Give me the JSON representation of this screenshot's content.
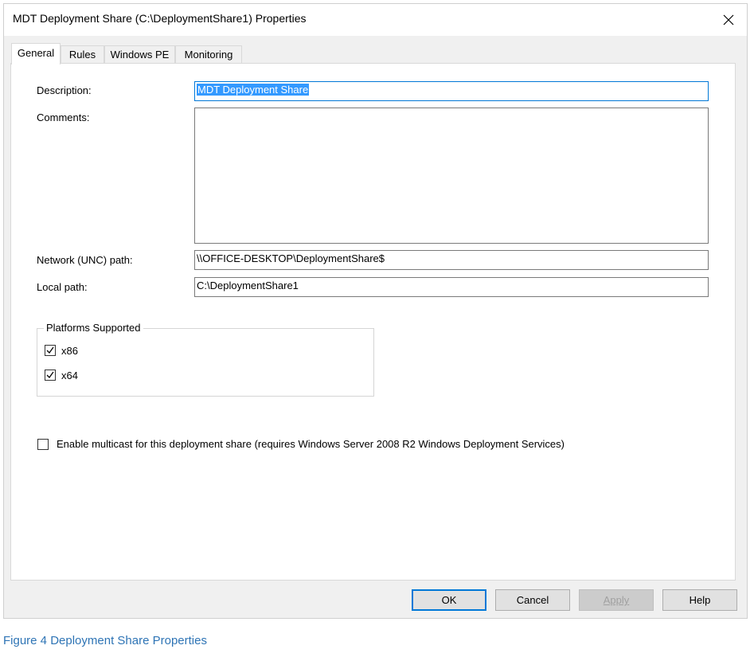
{
  "window": {
    "title": "MDT Deployment Share (C:\\DeploymentShare1) Properties"
  },
  "tabs": [
    {
      "label": "General",
      "active": true
    },
    {
      "label": "Rules",
      "active": false
    },
    {
      "label": "Windows PE",
      "active": false
    },
    {
      "label": "Monitoring",
      "active": false
    }
  ],
  "general": {
    "description_label": "Description:",
    "description_value": "MDT Deployment Share",
    "comments_label": "Comments:",
    "comments_value": "",
    "unc_label": "Network (UNC) path:",
    "unc_value": "\\\\OFFICE-DESKTOP\\DeploymentShare$",
    "local_label": "Local path:",
    "local_value": "C:\\DeploymentShare1",
    "platforms": {
      "legend": "Platforms Supported",
      "x86_label": "x86",
      "x86_checked": true,
      "x64_label": "x64",
      "x64_checked": true
    },
    "multicast_label": "Enable multicast for this deployment share (requires Windows Server 2008 R2 Windows Deployment Services)",
    "multicast_checked": false
  },
  "buttons": {
    "ok": "OK",
    "cancel": "Cancel",
    "apply": "Apply",
    "help": "Help"
  },
  "caption": "Figure 4 Deployment Share Properties",
  "colors": {
    "selection": "#3399ff",
    "default_button_border": "#0078d7",
    "caption": "#2e74b5"
  },
  "icons": {
    "close": "close-icon",
    "checkmark": "checkmark-icon"
  }
}
